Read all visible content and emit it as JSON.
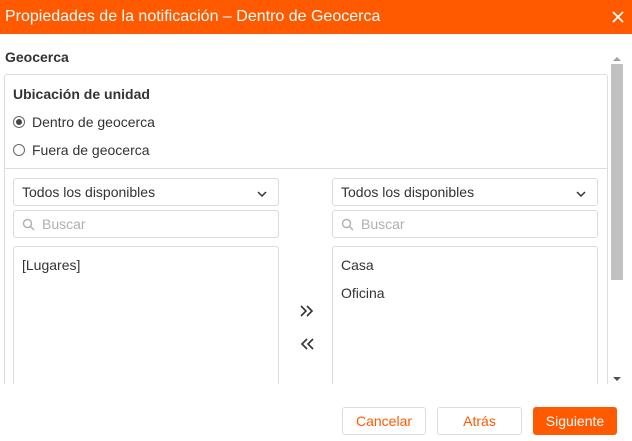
{
  "dialog": {
    "title": "Propiedades de la notificación – Dentro de Geocerca",
    "close_icon": "close-icon"
  },
  "section": {
    "title": "Geocerca"
  },
  "unit_location": {
    "label": "Ubicación de unidad",
    "options": [
      {
        "label": "Dentro de geocerca",
        "checked": true
      },
      {
        "label": "Fuera de geocerca",
        "checked": false
      }
    ]
  },
  "left_column": {
    "filter_value": "Todos los disponibles",
    "search_placeholder": "Buscar",
    "items": [
      "[Lugares]"
    ]
  },
  "right_column": {
    "filter_value": "Todos los disponibles",
    "search_placeholder": "Buscar",
    "items": [
      "Casa",
      "Oficina"
    ]
  },
  "transfer": {
    "add_icon": "double-chevron-right-icon",
    "remove_icon": "double-chevron-left-icon"
  },
  "footer": {
    "cancel_label": "Cancelar",
    "back_label": "Atrás",
    "next_label": "Siguiente"
  },
  "colors": {
    "accent": "#ff5a00",
    "border": "#dcdcdc",
    "text": "#333333"
  }
}
